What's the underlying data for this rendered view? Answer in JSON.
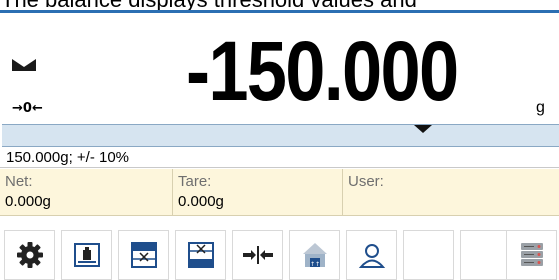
{
  "caption": "The balance displays threshold values and",
  "display": {
    "weight": "-150.000",
    "unit": "g",
    "stable_icon": "stability-indicator-icon",
    "zero_icon": "→0←"
  },
  "bargraph": {
    "marker_icon": "bargraph-marker-icon"
  },
  "threshold": {
    "text": "150.000g; +/- 10%"
  },
  "info": {
    "net_label": "Net:",
    "net_value": "0.000g",
    "tare_label": "Tare:",
    "tare_value": "0.000g",
    "user_label": "User:",
    "user_value": ""
  },
  "toolbar": {
    "buttons": [
      {
        "icon": "gear-icon"
      },
      {
        "icon": "tare-weight-icon"
      },
      {
        "icon": "lower-threshold-icon"
      },
      {
        "icon": "upper-threshold-icon"
      },
      {
        "icon": "target-value-icon"
      },
      {
        "icon": "mass-profile-icon"
      },
      {
        "icon": "user-icon"
      },
      {
        "icon": "empty"
      },
      {
        "icon": "empty"
      },
      {
        "icon": "database-icon"
      }
    ]
  },
  "colors": {
    "accent": "#2b6fb3",
    "info_bg": "#fdf6dc",
    "bargraph_bg": "#d6e4f0",
    "icon_blue": "#1f4e8c",
    "icon_red": "#d9534f"
  }
}
